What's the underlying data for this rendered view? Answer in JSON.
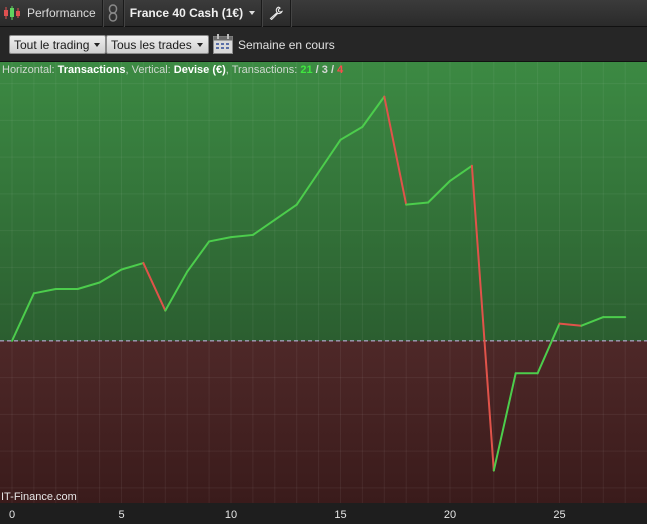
{
  "titlebar": {
    "app_label": "Performance",
    "instrument": "France 40 Cash (1€)"
  },
  "toolbar": {
    "trade_scope": "Tout le trading",
    "trade_filter": "Tous les trades",
    "period": "Semaine en cours"
  },
  "info": {
    "h_prefix": "Horizontal: ",
    "h_value": "Transactions",
    "v_prefix": ", Vertical: ",
    "v_value": "Devise (€)",
    "t_prefix": ", Transactions: ",
    "t_win": "21",
    "t_sep1": " / ",
    "t_neutral": "3",
    "t_sep2": " / ",
    "t_loss": "4"
  },
  "brand": "IT-Finance.com",
  "colors": {
    "gain_line": "#4ccd4c",
    "loss_line": "#e0534a",
    "positive_zone": "#2f6a34",
    "negative_zone": "#4a2424",
    "zero_line": "#c8b8e8"
  },
  "chart_data": {
    "type": "line",
    "title": "",
    "xlabel": "",
    "ylabel": "",
    "x_ticks": [
      0,
      5,
      10,
      15,
      20,
      25
    ],
    "xlim": [
      0,
      28.5
    ],
    "ylim": [
      -7.5,
      12.9
    ],
    "grid": true,
    "series": [
      {
        "x": [
          0,
          1,
          2,
          3,
          4,
          5,
          6,
          7,
          8,
          9,
          10,
          11,
          12,
          13,
          14,
          15,
          16,
          17,
          18,
          19,
          20,
          21,
          22,
          23,
          24,
          25,
          26,
          27,
          28
        ],
        "values": [
          0,
          2.2,
          2.4,
          2.4,
          2.7,
          3.3,
          3.6,
          1.4,
          3.2,
          4.6,
          4.8,
          4.9,
          5.6,
          6.3,
          7.8,
          9.3,
          9.9,
          11.3,
          6.3,
          6.4,
          7.4,
          8.1,
          -6.0,
          -1.5,
          -1.5,
          0.8,
          0.7,
          1.1,
          1.1
        ]
      }
    ]
  }
}
